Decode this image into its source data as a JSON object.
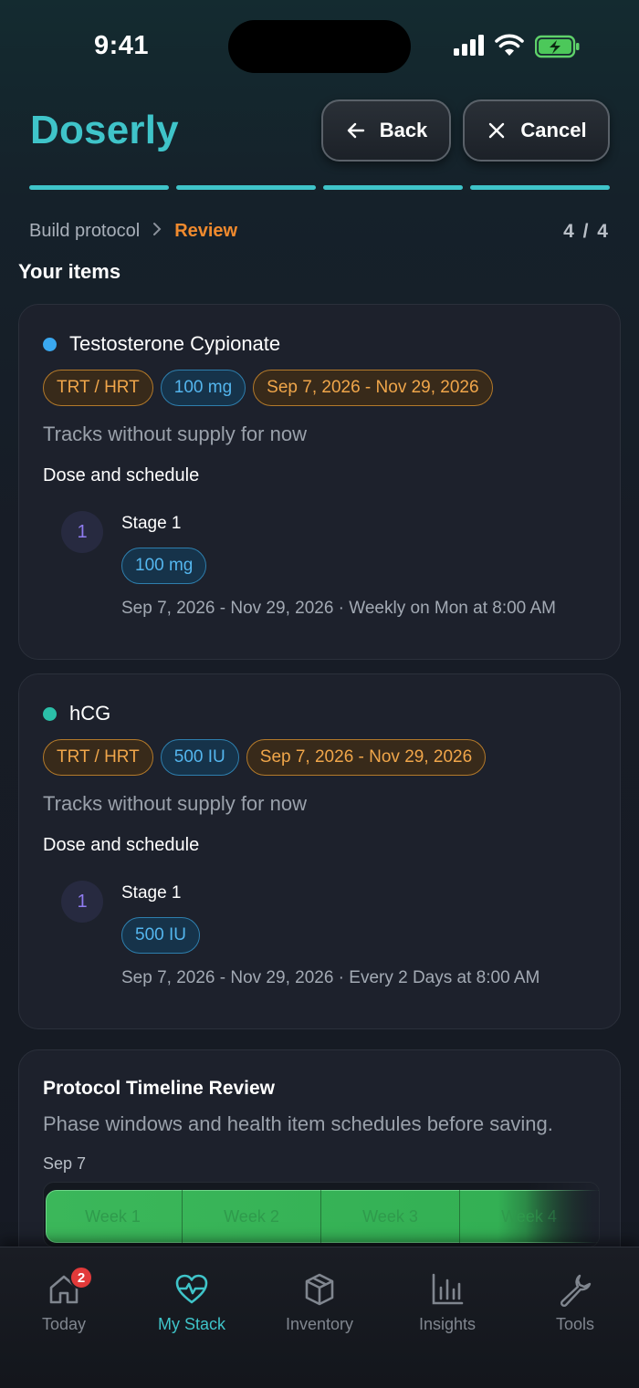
{
  "status_bar": {
    "time": "9:41"
  },
  "header": {
    "brand": "Doserly",
    "back_label": "Back",
    "cancel_label": "Cancel",
    "accent_color": "#3fc4c9"
  },
  "progress": {
    "segments_total": 4,
    "segments_done": 4
  },
  "breadcrumb": {
    "previous": "Build protocol",
    "current": "Review",
    "step": "4 / 4"
  },
  "section_title": "Your items",
  "items": [
    {
      "name": "Testosterone Cypionate",
      "dot_color": "#3aa8f0",
      "chips": [
        "TRT / HRT",
        "100 mg",
        "Sep 7, 2026 - Nov 29, 2026"
      ],
      "supply_note": "Tracks without supply for now",
      "dose_title": "Dose and schedule",
      "stage": {
        "number": "1",
        "label": "Stage 1",
        "dose": "100 mg",
        "detail": "Sep 7, 2026 - Nov 29, 2026 · Weekly on Mon at 8:00 AM"
      }
    },
    {
      "name": "hCG",
      "dot_color": "#2bbfa8",
      "chips": [
        "TRT / HRT",
        "500 IU",
        "Sep 7, 2026 - Nov 29, 2026"
      ],
      "supply_note": "Tracks without supply for now",
      "dose_title": "Dose and schedule",
      "stage": {
        "number": "1",
        "label": "Stage 1",
        "dose": "500 IU",
        "detail": "Sep 7, 2026 - Nov 29, 2026 · Every 2 Days at 8:00 AM"
      }
    }
  ],
  "timeline": {
    "title": "Protocol Timeline Review",
    "subtitle": "Phase windows and health item schedules before saving.",
    "start_date": "Sep 7",
    "weeks": [
      "Week 1",
      "Week 2",
      "Week 3",
      "Week 4"
    ],
    "bar_color": "#3bb75a"
  },
  "bottom_nav": {
    "items": [
      {
        "label": "Today",
        "icon": "home-icon",
        "badge": "2"
      },
      {
        "label": "My Stack",
        "icon": "heart-pulse-icon",
        "active": true
      },
      {
        "label": "Inventory",
        "icon": "box-icon"
      },
      {
        "label": "Insights",
        "icon": "bar-chart-icon"
      },
      {
        "label": "Tools",
        "icon": "wrench-icon"
      }
    ]
  }
}
